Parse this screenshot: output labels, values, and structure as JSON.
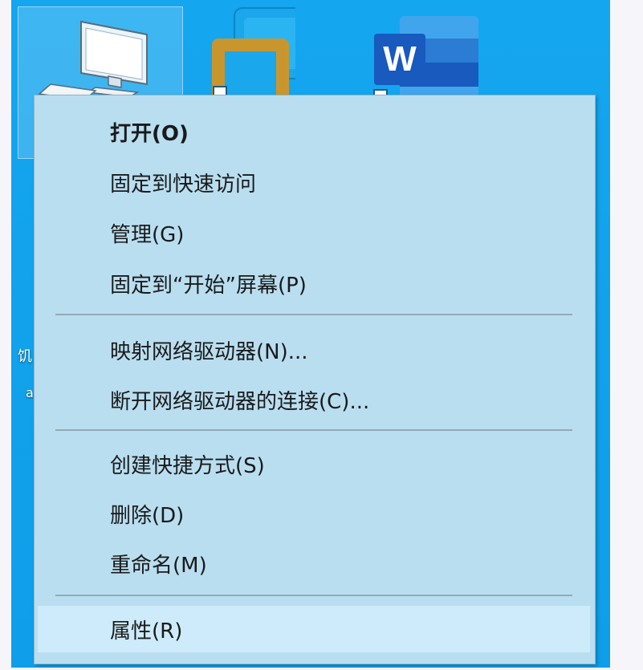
{
  "desktop": {
    "icons": [
      {
        "name": "this-pc-icon"
      },
      {
        "name": "app-shortcut-icon"
      },
      {
        "name": "word-icon",
        "glyph": "W"
      }
    ],
    "left_label_fragment": "饥",
    "left_label_fragment2": "a"
  },
  "menu": {
    "groups": [
      {
        "items": [
          {
            "label": "打开(O)",
            "bold": true
          },
          {
            "label": "固定到快速访问"
          },
          {
            "label": "管理(G)"
          },
          {
            "label": "固定到“开始”屏幕(P)"
          }
        ]
      },
      {
        "items": [
          {
            "label": "映射网络驱动器(N)..."
          },
          {
            "label": "断开网络驱动器的连接(C)..."
          }
        ]
      },
      {
        "items": [
          {
            "label": "创建快捷方式(S)"
          },
          {
            "label": "删除(D)"
          },
          {
            "label": "重命名(M)"
          }
        ]
      },
      {
        "items": [
          {
            "label": "属性(R)",
            "highlighted": true
          }
        ]
      }
    ]
  },
  "colors": {
    "desktop_blue": "#14a6ee",
    "menu_bg": "#b9def0",
    "menu_hover": "#cdebfa",
    "word_blue": "#2b62c8"
  }
}
